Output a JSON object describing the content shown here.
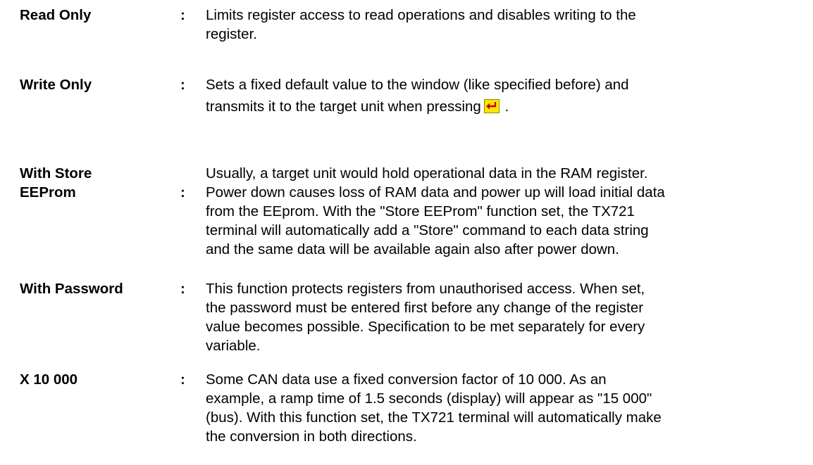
{
  "entries": [
    {
      "term": "Read Only",
      "colon": ":",
      "desc_lines": [
        "Limits register access to read operations and disables writing to the",
        "register."
      ]
    },
    {
      "term": "Write Only",
      "colon": ":",
      "desc_lines": [
        "Sets a fixed default value to the window (like specified before) and",
        "transmits it to the target unit when pressing"
      ],
      "desc_after_icon": ".",
      "icon": "enter-key-icon"
    },
    {
      "term_lines": [
        "With Store",
        "EEProm"
      ],
      "colon": ":",
      "desc_lines": [
        "Usually, a target unit would hold operational data in the RAM register.",
        "Power down causes loss of RAM data and power up will load initial data",
        "from the EEprom. With the \"Store EEProm\" function set, the TX721",
        "terminal will automatically add a \"Store\" command to each data string",
        "and the same data will be available again also after power down."
      ]
    },
    {
      "term": "With Password",
      "colon": ":",
      "desc_lines": [
        "This function protects registers from unauthorised access. When set,",
        "the password must be entered first before any change of the register",
        "value becomes possible. Specification to be met separately for every",
        "variable."
      ]
    },
    {
      "term": "X 10 000",
      "colon": ":",
      "desc_lines": [
        "Some CAN data use a fixed conversion factor of 10 000. As an",
        "example, a ramp time of 1.5 seconds (display) will appear as \"15 000\"",
        "(bus). With this function set, the TX721 terminal will automatically make",
        "the conversion in both directions."
      ]
    }
  ],
  "colors": {
    "text": "#000000",
    "enter_icon_fill": "#ffe600",
    "enter_icon_arrow": "#cc0000"
  }
}
